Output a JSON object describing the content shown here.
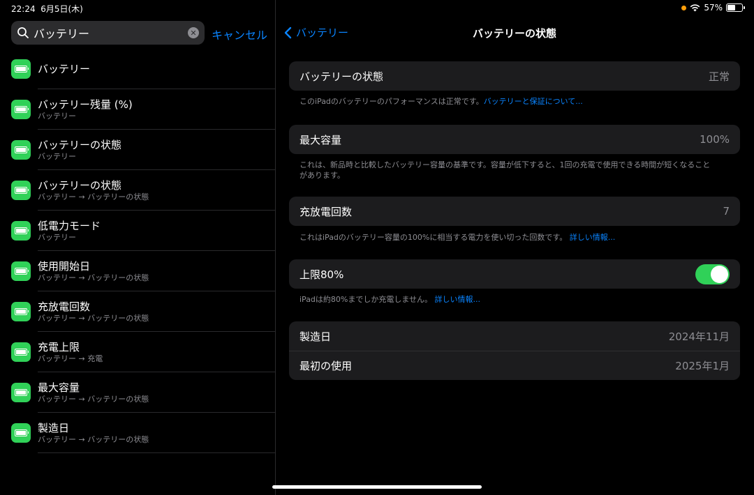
{
  "status": {
    "time": "22:24",
    "date": "6月5日(木)",
    "battery_pct": "57%",
    "battery_level": 0.57
  },
  "search": {
    "query": "バッテリー",
    "cancel_label": "キャンセル"
  },
  "results": [
    {
      "title": "バッテリー",
      "subtitle": ""
    },
    {
      "title": "バッテリー残量 (%)",
      "subtitle": "バッテリー"
    },
    {
      "title": "バッテリーの状態",
      "subtitle": "バッテリー"
    },
    {
      "title": "バッテリーの状態",
      "subtitle": "バッテリー → バッテリーの状態"
    },
    {
      "title": "低電力モード",
      "subtitle": "バッテリー"
    },
    {
      "title": "使用開始日",
      "subtitle": "バッテリー → バッテリーの状態"
    },
    {
      "title": "充放電回数",
      "subtitle": "バッテリー → バッテリーの状態"
    },
    {
      "title": "充電上限",
      "subtitle": "バッテリー → 充電"
    },
    {
      "title": "最大容量",
      "subtitle": "バッテリー → バッテリーの状態"
    },
    {
      "title": "製造日",
      "subtitle": "バッテリー → バッテリーの状態"
    }
  ],
  "nav": {
    "back_label": "バッテリー",
    "title": "バッテリーの状態"
  },
  "health": {
    "label": "バッテリーの状態",
    "value": "正常",
    "footnote": "このiPadのバッテリーのパフォーマンスは正常です。",
    "footnote_link": "バッテリーと保証について..."
  },
  "capacity": {
    "label": "最大容量",
    "value": "100%",
    "footnote": "これは、新品時と比較したバッテリー容量の基準です。容量が低下すると、1回の充電で使用できる時間が短くなることがあります。"
  },
  "cycles": {
    "label": "充放電回数",
    "value": "7",
    "footnote": "これはiPadのバッテリー容量の100%に相当する電力を使い切った回数です。",
    "footnote_link": "詳しい情報..."
  },
  "limit": {
    "label": "上限80%",
    "enabled": true,
    "footnote": "iPadは約80%までしか充電しません。",
    "footnote_link": "詳しい情報..."
  },
  "dates": {
    "manufacture_label": "製造日",
    "manufacture_value": "2024年11月",
    "first_use_label": "最初の使用",
    "first_use_value": "2025年1月"
  }
}
